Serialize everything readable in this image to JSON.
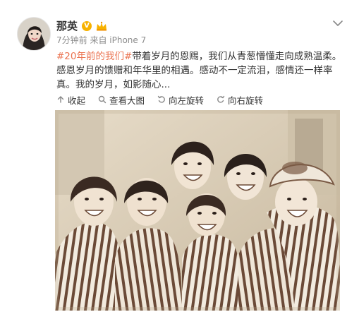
{
  "post": {
    "author": "那英",
    "meta": "7分钟前 来自 iPhone 7",
    "hashtag": "#20年前的我们#",
    "text": "带着岁月的恩赐，我们从青葱懵懂走向成熟温柔。感恩岁月的馈赠和年华里的相遇。感动不一定流泪，感情还一样率真。我的岁月，如影随心..."
  },
  "actions": {
    "collapse": "收起",
    "view_large": "查看大图",
    "rotate_left": "向左旋转",
    "rotate_right": "向右旋转"
  },
  "colors": {
    "hashtag": "#eb7350",
    "meta": "#8c8c8c",
    "vip": "#f7b200"
  },
  "icons": {
    "verified": "v-badge-icon",
    "crown": "crown-icon",
    "dropdown": "chevron-down-icon",
    "collapse": "arrow-up-icon",
    "zoom": "magnifier-icon",
    "rotate_left": "rotate-left-icon",
    "rotate_right": "rotate-right-icon"
  }
}
